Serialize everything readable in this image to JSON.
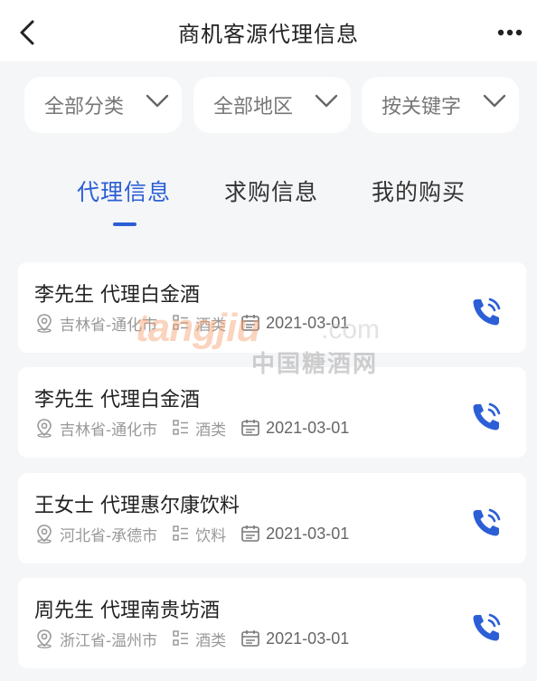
{
  "header": {
    "title": "商机客源代理信息"
  },
  "filters": [
    {
      "label": "全部分类"
    },
    {
      "label": "全部地区"
    },
    {
      "label": "按关键字"
    }
  ],
  "tabs": [
    {
      "label": "代理信息",
      "active": true
    },
    {
      "label": "求购信息",
      "active": false
    },
    {
      "label": "我的购买",
      "active": false
    }
  ],
  "listings": [
    {
      "title": "李先生 代理白金酒",
      "location": "吉林省-通化市",
      "category": "酒类",
      "date": "2021-03-01"
    },
    {
      "title": "李先生 代理白金酒",
      "location": "吉林省-通化市",
      "category": "酒类",
      "date": "2021-03-01"
    },
    {
      "title": "王女士 代理惠尔康饮料",
      "location": "河北省-承德市",
      "category": "饮料",
      "date": "2021-03-01"
    },
    {
      "title": "周先生 代理南贵坊酒",
      "location": "浙江省-温州市",
      "category": "酒类",
      "date": "2021-03-01"
    }
  ],
  "watermark": {
    "logo": "tangjiu",
    "domain": ".com",
    "cn": "中国糖酒网"
  },
  "colors": {
    "accent": "#2c5fd6",
    "background": "#f5f6f8"
  },
  "icons": {
    "back": "back-arrow-icon",
    "more": "more-dots-icon",
    "filter": "chevron-down-icon",
    "location": "location-pin-icon",
    "category": "category-list-icon",
    "date": "calendar-icon",
    "call": "phone-call-icon"
  }
}
